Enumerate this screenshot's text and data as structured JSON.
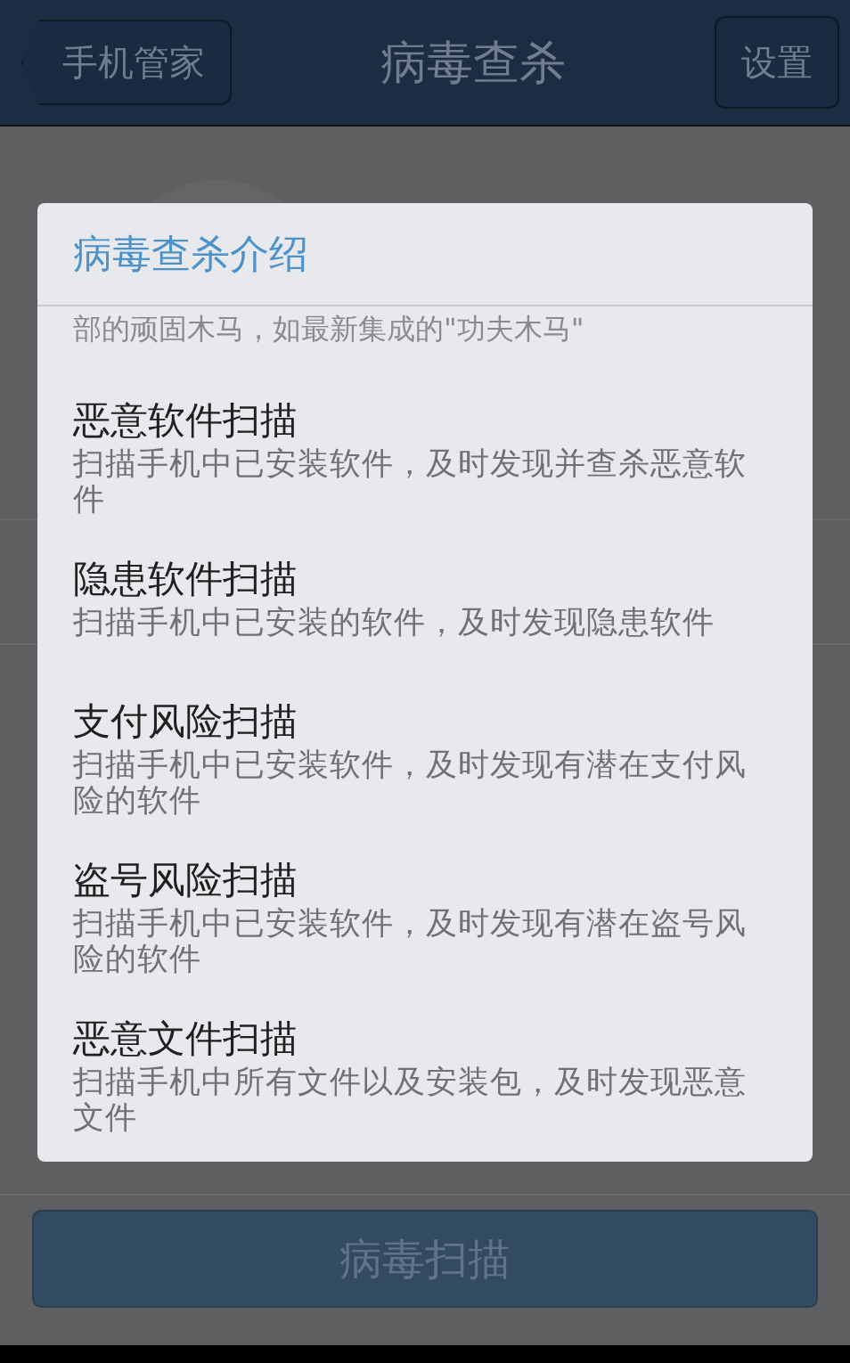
{
  "header": {
    "back_button": "手机管家",
    "title": "病毒查杀",
    "settings_button": "设置"
  },
  "dialog": {
    "title": "病毒查杀介绍",
    "partial_line": "部的顽固木马，如最新集成的\"功夫木马\"",
    "items": [
      {
        "title": "恶意软件扫描",
        "description": "扫描手机中已安装软件，及时发现并查杀恶意软件"
      },
      {
        "title": "隐患软件扫描",
        "description": "扫描手机中已安装的软件，及时发现隐患软件"
      },
      {
        "title": "支付风险扫描",
        "description": "扫描手机中已安装软件，及时发现有潜在支付风险的软件"
      },
      {
        "title": "盗号风险扫描",
        "description": "扫描手机中已安装软件，及时发现有潜在盗号风险的软件"
      },
      {
        "title": "恶意文件扫描",
        "description": "扫描手机中所有文件以及安装包，及时发现恶意文件"
      }
    ]
  },
  "scan_button": "病毒扫描"
}
